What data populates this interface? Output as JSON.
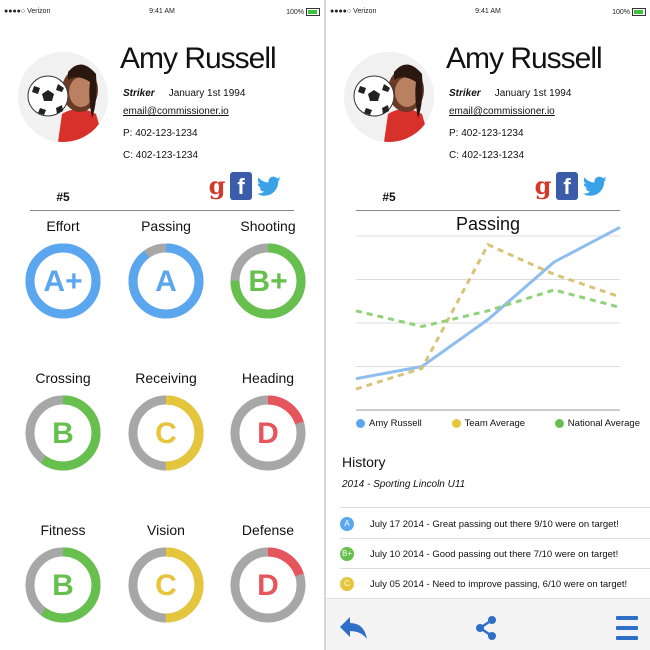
{
  "status": {
    "carrier": "Verizon",
    "time": "9:41 AM",
    "battery": "100%"
  },
  "player": {
    "name": "Amy Russell",
    "position": "Striker",
    "dob": "January 1st 1994",
    "email": "email@commissioner.io",
    "phone": "P: 402-123-1234",
    "cell": "C: 402-123-1234",
    "number": "#5"
  },
  "colors": {
    "blue": "#5aa7f0",
    "green": "#67c04e",
    "yellow": "#e5c53b",
    "red": "#e6545c",
    "gray": "#a7a7a7"
  },
  "grades": [
    {
      "label": "Effort",
      "grade": "A+",
      "color": "#5aa7f0",
      "fraction": 1.0
    },
    {
      "label": "Passing",
      "grade": "A",
      "color": "#5aa7f0",
      "fraction": 0.9
    },
    {
      "label": "Shooting",
      "grade": "B+",
      "color": "#67c04e",
      "fraction": 0.75
    },
    {
      "label": "Crossing",
      "grade": "B",
      "color": "#67c04e",
      "fraction": 0.6
    },
    {
      "label": "Receiving",
      "grade": "C",
      "color": "#e5c53b",
      "fraction": 0.5
    },
    {
      "label": "Heading",
      "grade": "D",
      "color": "#e6545c",
      "fraction": 0.2
    },
    {
      "label": "Fitness",
      "grade": "B",
      "color": "#67c04e",
      "fraction": 0.6
    },
    {
      "label": "Vision",
      "grade": "C",
      "color": "#e5c53b",
      "fraction": 0.5
    },
    {
      "label": "Defense",
      "grade": "D",
      "color": "#e6545c",
      "fraction": 0.2
    }
  ],
  "chart_data": {
    "type": "line",
    "title": "Passing",
    "x": [
      1,
      2,
      3,
      4,
      5
    ],
    "ylim": [
      0,
      10
    ],
    "grid": true,
    "legend_position": "bottom",
    "series": [
      {
        "name": "Amy Russell",
        "color": "#8fbdf0",
        "style": "solid",
        "values": [
          1.8,
          2.5,
          5.2,
          8.5,
          10.5
        ]
      },
      {
        "name": "Team Average",
        "color": "#d8c37a",
        "style": "dashed",
        "values": [
          1.2,
          2.4,
          9.5,
          7.8,
          6.5
        ]
      },
      {
        "name": "National Average",
        "color": "#8fd27a",
        "style": "dashed",
        "values": [
          5.7,
          4.8,
          5.7,
          6.9,
          5.9
        ]
      }
    ]
  },
  "history": {
    "title": "History",
    "subtitle": "2014 - Sporting Lincoln U11",
    "entries": [
      {
        "badge": "A",
        "color": "#5aa7f0",
        "text": "July 17 2014 - Great passing out there 9/10 were on target!"
      },
      {
        "badge": "B+",
        "color": "#67c04e",
        "text": "July 10 2014 - Good passing out there 7/10 were on target!"
      },
      {
        "badge": "C",
        "color": "#e5c53b",
        "text": "July 05 2014 - Need to improve passing, 6/10 were on target!"
      }
    ]
  },
  "icons": {
    "back": "back-arrow-icon",
    "share": "share-icon",
    "menu": "menu-icon",
    "google": "google-icon",
    "facebook": "facebook-icon",
    "twitter": "twitter-icon"
  }
}
